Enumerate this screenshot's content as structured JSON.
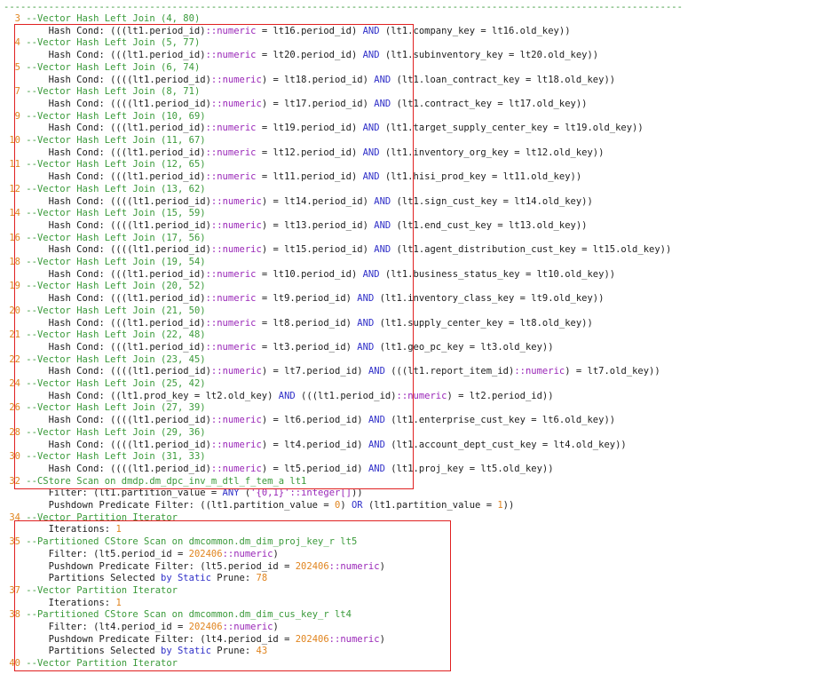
{
  "top_rule": "-------------------------------------------------------------------------------------------------------------------------",
  "rows": [
    [
      [
        "ln",
        "  3 "
      ],
      [
        "cm",
        "--Vector Hash Left Join (4, 80)"
      ]
    ],
    [
      [
        "",
        "        Hash Cond: ((("
      ],
      [
        "",
        "lt1.period_id"
      ],
      [
        "",
        ")"
      ],
      [
        "cf",
        "::numeric"
      ],
      [
        "",
        " = lt16.period_id) "
      ],
      [
        "kw",
        "AND"
      ],
      [
        "",
        " (lt1.company_key = lt16.old_key))"
      ]
    ],
    [
      [
        "ln",
        "  4 "
      ],
      [
        "cm",
        "--Vector Hash Left Join (5, 77)"
      ]
    ],
    [
      [
        "",
        "        Hash Cond: ((("
      ],
      [
        "",
        "lt1.period_id"
      ],
      [
        "",
        ")"
      ],
      [
        "cf",
        "::numeric"
      ],
      [
        "",
        " = lt20.period_id) "
      ],
      [
        "kw",
        "AND"
      ],
      [
        "",
        " (lt1.subinventory_key = lt20.old_key))"
      ]
    ],
    [
      [
        "ln",
        "  5 "
      ],
      [
        "cm",
        "--Vector Hash Left Join (6, 74)"
      ]
    ],
    [
      [
        "",
        "        Hash Cond: (((("
      ],
      [
        "",
        "lt1.period_id"
      ],
      [
        "",
        ")"
      ],
      [
        "cf",
        "::numeric"
      ],
      [
        "",
        ") = lt18.period_id) "
      ],
      [
        "kw",
        "AND"
      ],
      [
        "",
        " (lt1.loan_contract_key = lt18.old_key))"
      ]
    ],
    [
      [
        "ln",
        "  7 "
      ],
      [
        "cm",
        "--Vector Hash Left Join (8, 71)"
      ]
    ],
    [
      [
        "",
        "        Hash Cond: (((("
      ],
      [
        "",
        "lt1.period_id"
      ],
      [
        "",
        ")"
      ],
      [
        "cf",
        "::numeric"
      ],
      [
        "",
        ") = lt17.period_id) "
      ],
      [
        "kw",
        "AND"
      ],
      [
        "",
        " (lt1.contract_key = lt17.old_key))"
      ]
    ],
    [
      [
        "ln",
        "  9 "
      ],
      [
        "cm",
        "--Vector Hash Left Join (10, 69)"
      ]
    ],
    [
      [
        "",
        "        Hash Cond: ((("
      ],
      [
        "",
        "lt1.period_id"
      ],
      [
        "",
        ")"
      ],
      [
        "cf",
        "::numeric"
      ],
      [
        "",
        " = lt19.period_id) "
      ],
      [
        "kw",
        "AND"
      ],
      [
        "",
        " (lt1.target_supply_center_key = lt19.old_key))"
      ]
    ],
    [
      [
        "ln",
        " 10 "
      ],
      [
        "cm",
        "--Vector Hash Left Join (11, 67)"
      ]
    ],
    [
      [
        "",
        "        Hash Cond: ((("
      ],
      [
        "",
        "lt1.period_id"
      ],
      [
        "",
        ")"
      ],
      [
        "cf",
        "::numeric"
      ],
      [
        "",
        " = lt12.period_id) "
      ],
      [
        "kw",
        "AND"
      ],
      [
        "",
        " (lt1.inventory_org_key = lt12.old_key))"
      ]
    ],
    [
      [
        "ln",
        " 11 "
      ],
      [
        "cm",
        "--Vector Hash Left Join (12, 65)"
      ]
    ],
    [
      [
        "",
        "        Hash Cond: ((("
      ],
      [
        "",
        "lt1.period_id"
      ],
      [
        "",
        ")"
      ],
      [
        "cf",
        "::numeric"
      ],
      [
        "",
        " = lt11.period_id) "
      ],
      [
        "kw",
        "AND"
      ],
      [
        "",
        " (lt1.hisi_prod_key = lt11.old_key))"
      ]
    ],
    [
      [
        "ln",
        " 12 "
      ],
      [
        "cm",
        "--Vector Hash Left Join (13, 62)"
      ]
    ],
    [
      [
        "",
        "        Hash Cond: (((("
      ],
      [
        "",
        "lt1.period_id"
      ],
      [
        "",
        ")"
      ],
      [
        "cf",
        "::numeric"
      ],
      [
        "",
        ") = lt14.period_id) "
      ],
      [
        "kw",
        "AND"
      ],
      [
        "",
        " (lt1.sign_cust_key = lt14.old_key))"
      ]
    ],
    [
      [
        "ln",
        " 14 "
      ],
      [
        "cm",
        "--Vector Hash Left Join (15, 59)"
      ]
    ],
    [
      [
        "",
        "        Hash Cond: (((("
      ],
      [
        "",
        "lt1.period_id"
      ],
      [
        "",
        ")"
      ],
      [
        "cf",
        "::numeric"
      ],
      [
        "",
        ") = lt13.period_id) "
      ],
      [
        "kw",
        "AND"
      ],
      [
        "",
        " (lt1.end_cust_key = lt13.old_key))"
      ]
    ],
    [
      [
        "ln",
        " 16 "
      ],
      [
        "cm",
        "--Vector Hash Left Join (17, 56)"
      ]
    ],
    [
      [
        "",
        "        Hash Cond: (((("
      ],
      [
        "",
        "lt1.period_id"
      ],
      [
        "",
        ")"
      ],
      [
        "cf",
        "::numeric"
      ],
      [
        "",
        ") = lt15.period_id) "
      ],
      [
        "kw",
        "AND"
      ],
      [
        "",
        " (lt1.agent_distribution_cust_key = lt15.old_key))"
      ]
    ],
    [
      [
        "ln",
        " 18 "
      ],
      [
        "cm",
        "--Vector Hash Left Join (19, 54)"
      ]
    ],
    [
      [
        "",
        "        Hash Cond: ((("
      ],
      [
        "",
        "lt1.period_id"
      ],
      [
        "",
        ")"
      ],
      [
        "cf",
        "::numeric"
      ],
      [
        "",
        " = lt10.period_id) "
      ],
      [
        "kw",
        "AND"
      ],
      [
        "",
        " (lt1.business_status_key = lt10.old_key))"
      ]
    ],
    [
      [
        "ln",
        " 19 "
      ],
      [
        "cm",
        "--Vector Hash Left Join (20, 52)"
      ]
    ],
    [
      [
        "",
        "        Hash Cond: ((("
      ],
      [
        "",
        "lt1.period_id"
      ],
      [
        "",
        ")"
      ],
      [
        "cf",
        "::numeric"
      ],
      [
        "",
        " = lt9.period_id) "
      ],
      [
        "kw",
        "AND"
      ],
      [
        "",
        " (lt1.inventory_class_key = lt9.old_key))"
      ]
    ],
    [
      [
        "ln",
        " 20 "
      ],
      [
        "cm",
        "--Vector Hash Left Join (21, 50)"
      ]
    ],
    [
      [
        "",
        "        Hash Cond: ((("
      ],
      [
        "",
        "lt1.period_id"
      ],
      [
        "",
        ")"
      ],
      [
        "cf",
        "::numeric"
      ],
      [
        "",
        " = lt8.period_id) "
      ],
      [
        "kw",
        "AND"
      ],
      [
        "",
        " (lt1.supply_center_key = lt8.old_key))"
      ]
    ],
    [
      [
        "ln",
        " 21 "
      ],
      [
        "cm",
        "--Vector Hash Left Join (22, 48)"
      ]
    ],
    [
      [
        "",
        "        Hash Cond: ((("
      ],
      [
        "",
        "lt1.period_id"
      ],
      [
        "",
        ")"
      ],
      [
        "cf",
        "::numeric"
      ],
      [
        "",
        " = lt3.period_id) "
      ],
      [
        "kw",
        "AND"
      ],
      [
        "",
        " (lt1.geo_pc_key = lt3.old_key))"
      ]
    ],
    [
      [
        "ln",
        " 22 "
      ],
      [
        "cm",
        "--Vector Hash Left Join (23, 45)"
      ]
    ],
    [
      [
        "",
        "        Hash Cond: (((("
      ],
      [
        "",
        "lt1.period_id"
      ],
      [
        "",
        ")"
      ],
      [
        "cf",
        "::numeric"
      ],
      [
        "",
        ") = lt7.period_id) "
      ],
      [
        "kw",
        "AND"
      ],
      [
        "",
        " ((("
      ],
      [
        "",
        "lt1.report_item_id"
      ],
      [
        "",
        ")"
      ],
      [
        "cf",
        "::numeric"
      ],
      [
        "",
        ") = lt7.old_key))"
      ]
    ],
    [
      [
        "ln",
        " 24 "
      ],
      [
        "cm",
        "--Vector Hash Left Join (25, 42)"
      ]
    ],
    [
      [
        "",
        "        Hash Cond: ((lt1.prod_key = lt2.old_key) "
      ],
      [
        "kw",
        "AND"
      ],
      [
        "",
        " ((("
      ],
      [
        "",
        "lt1.period_id"
      ],
      [
        "",
        ")"
      ],
      [
        "cf",
        "::numeric"
      ],
      [
        "",
        ") = lt2.period_id))"
      ]
    ],
    [
      [
        "ln",
        " 26 "
      ],
      [
        "cm",
        "--Vector Hash Left Join (27, 39)"
      ]
    ],
    [
      [
        "",
        "        Hash Cond: (((("
      ],
      [
        "",
        "lt1.period_id"
      ],
      [
        "",
        ")"
      ],
      [
        "cf",
        "::numeric"
      ],
      [
        "",
        ") = lt6.period_id) "
      ],
      [
        "kw",
        "AND"
      ],
      [
        "",
        " (lt1.enterprise_cust_key = lt6.old_key))"
      ]
    ],
    [
      [
        "ln",
        " 28 "
      ],
      [
        "cm",
        "--Vector Hash Left Join (29, 36)"
      ]
    ],
    [
      [
        "",
        "        Hash Cond: (((("
      ],
      [
        "",
        "lt1.period_id"
      ],
      [
        "",
        ")"
      ],
      [
        "cf",
        "::numeric"
      ],
      [
        "",
        ") = lt4.period_id) "
      ],
      [
        "kw",
        "AND"
      ],
      [
        "",
        " (lt1.account_dept_cust_key = lt4.old_key))"
      ]
    ],
    [
      [
        "ln",
        " 30 "
      ],
      [
        "cm",
        "--Vector Hash Left Join (31, 33)"
      ]
    ],
    [
      [
        "",
        "        Hash Cond: (((("
      ],
      [
        "",
        "lt1.period_id"
      ],
      [
        "",
        ")"
      ],
      [
        "cf",
        "::numeric"
      ],
      [
        "",
        ") = lt5.period_id) "
      ],
      [
        "kw",
        "AND"
      ],
      [
        "",
        " (lt1.proj_key = lt5.old_key))"
      ]
    ],
    [
      [
        "ln",
        " 32 "
      ],
      [
        "cm",
        "--CStore Scan on dmdp.dm_dpc_inv_m_dtl_f_tem_a lt1"
      ]
    ],
    [
      [
        "",
        "        Filter: (lt1.partition_value = "
      ],
      [
        "kw",
        "ANY"
      ],
      [
        "",
        " ("
      ],
      [
        "str",
        "'{0,1}'"
      ],
      [
        "cf",
        "::integer[]"
      ],
      [
        "",
        "))"
      ]
    ],
    [
      [
        "",
        "        Pushdown Predicate Filter: ((lt1.partition_value = "
      ],
      [
        "num",
        "0"
      ],
      [
        "",
        ") "
      ],
      [
        "kw",
        "OR"
      ],
      [
        "",
        " (lt1.partition_value = "
      ],
      [
        "num",
        "1"
      ],
      [
        "",
        "))"
      ]
    ],
    [
      [
        "ln",
        " 34 "
      ],
      [
        "cm",
        "--Vector Partition Iterator"
      ]
    ],
    [
      [
        "",
        "        Iterations: "
      ],
      [
        "num",
        "1"
      ]
    ],
    [
      [
        "ln",
        " 35 "
      ],
      [
        "cm",
        "--Partitioned CStore Scan on dmcommon.dm_dim_proj_key_r lt5"
      ]
    ],
    [
      [
        "",
        "        Filter: (lt5.period_id = "
      ],
      [
        "num",
        "202406"
      ],
      [
        "cf",
        "::numeric"
      ],
      [
        "",
        ")"
      ]
    ],
    [
      [
        "",
        "        Pushdown Predicate Filter: (lt5.period_id = "
      ],
      [
        "num",
        "202406"
      ],
      [
        "cf",
        "::numeric"
      ],
      [
        "",
        ")"
      ]
    ],
    [
      [
        "",
        "        Partitions Selected "
      ],
      [
        "kw",
        "by Static"
      ],
      [
        "",
        " Prune: "
      ],
      [
        "num",
        "78"
      ]
    ],
    [
      [
        "ln",
        " 37 "
      ],
      [
        "cm",
        "--Vector Partition Iterator"
      ]
    ],
    [
      [
        "",
        "        Iterations: "
      ],
      [
        "num",
        "1"
      ]
    ],
    [
      [
        "ln",
        " 38 "
      ],
      [
        "cm",
        "--Partitioned CStore Scan on dmcommon.dm_dim_cus_key_r lt4"
      ]
    ],
    [
      [
        "",
        "        Filter: (lt4.period_id = "
      ],
      [
        "num",
        "202406"
      ],
      [
        "cf",
        "::numeric"
      ],
      [
        "",
        ")"
      ]
    ],
    [
      [
        "",
        "        Pushdown Predicate Filter: (lt4.period_id = "
      ],
      [
        "num",
        "202406"
      ],
      [
        "cf",
        "::numeric"
      ],
      [
        "",
        ")"
      ]
    ],
    [
      [
        "",
        "        Partitions Selected "
      ],
      [
        "kw",
        "by Static"
      ],
      [
        "",
        " Prune: "
      ],
      [
        "num",
        "43"
      ]
    ],
    [
      [
        "ln",
        " 40 "
      ],
      [
        "cm",
        "--Vector Partition Iterator"
      ]
    ]
  ]
}
